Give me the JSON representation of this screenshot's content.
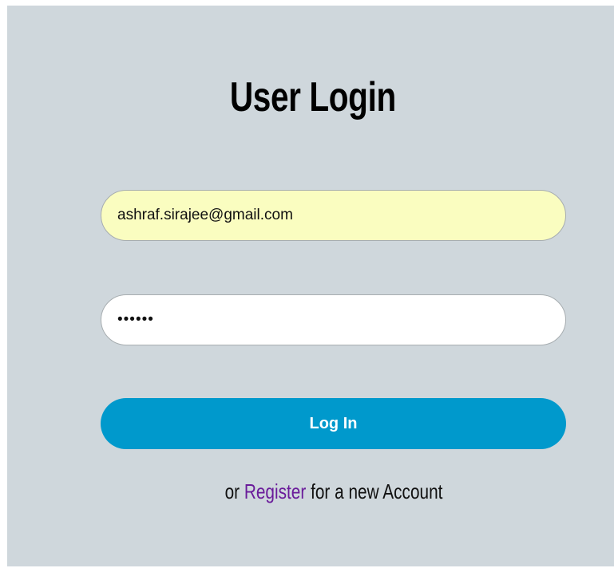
{
  "form": {
    "title": "User Login",
    "email_value": "ashraf.sirajee@gmail.com",
    "password_value": "••••••",
    "login_button_label": "Log In",
    "register_prefix": "or ",
    "register_link_label": "Register",
    "register_suffix": " for a new Account"
  },
  "colors": {
    "background": "#cfd7dc",
    "email_autofill": "#fafdc0",
    "button": "#0099cc",
    "link": "#6a1b9a"
  }
}
